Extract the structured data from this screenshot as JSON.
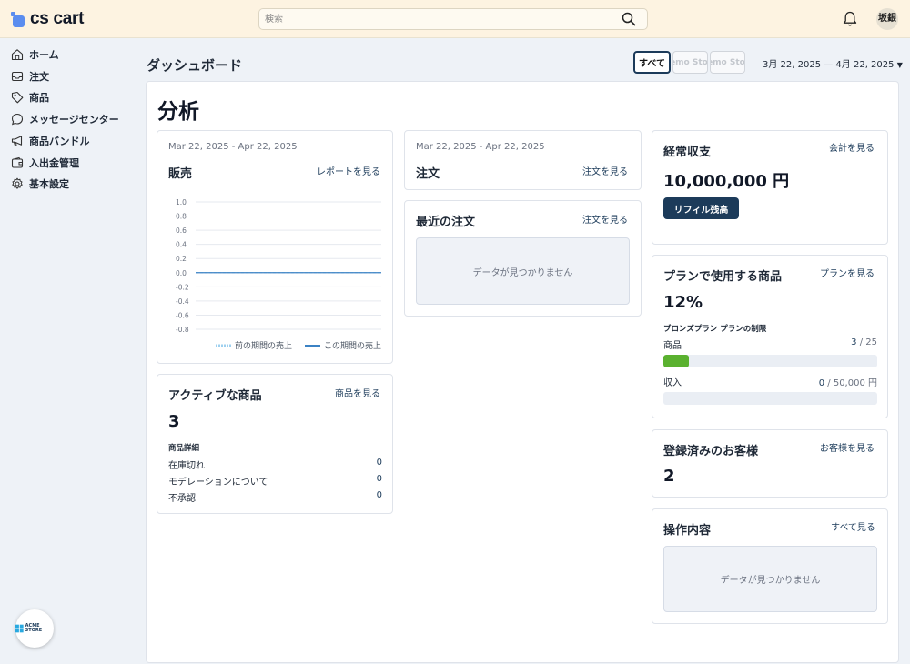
{
  "header": {
    "logo_text": "cs cart",
    "search_placeholder": "検索",
    "user_initials": "坂銀"
  },
  "sidebar": {
    "items": [
      {
        "label": "ホーム",
        "icon": "home-icon"
      },
      {
        "label": "注文",
        "icon": "inbox-icon"
      },
      {
        "label": "商品",
        "icon": "tag-icon"
      },
      {
        "label": "メッセージセンター",
        "icon": "chat-icon"
      },
      {
        "label": "商品バンドル",
        "icon": "megaphone-icon"
      },
      {
        "label": "入出金管理",
        "icon": "wallet-icon"
      },
      {
        "label": "基本設定",
        "icon": "gear-icon"
      }
    ],
    "store_logo_text": "ACME STORE"
  },
  "page": {
    "title": "ダッシュボード",
    "store_filters": [
      "すべて",
      "Demo Store",
      "Demo Store"
    ],
    "date_range": "3月 22, 2025 — 4月 22, 2025",
    "section_title": "分析"
  },
  "sales": {
    "date": "Mar 22, 2025 - Apr 22, 2025",
    "title": "販売",
    "link": "レポートを見る",
    "legend_prev": "前の期間の売上",
    "legend_curr": "この期間の売上"
  },
  "chart_data": {
    "type": "line",
    "ylim": [
      -0.8,
      1.0
    ],
    "yticks": [
      "1.0",
      "0.8",
      "0.6",
      "0.4",
      "0.2",
      "0.0",
      "-0.2",
      "-0.4",
      "-0.6",
      "-0.8"
    ],
    "series": [
      {
        "name": "前の期間の売上",
        "values": [
          0,
          0
        ],
        "color": "#9ed0ef"
      },
      {
        "name": "この期間の売上",
        "values": [
          0,
          0
        ],
        "color": "#3b82c4"
      }
    ],
    "grid": true,
    "legend": "bottom-right"
  },
  "orders": {
    "date": "Mar 22, 2025 - Apr 22, 2025",
    "title": "注文",
    "link": "注文を見る"
  },
  "recent_orders": {
    "title": "最近の注文",
    "link": "注文を見る",
    "empty": "データが見つかりません"
  },
  "active_products": {
    "title": "アクティブな商品",
    "link": "商品を見る",
    "value": "3",
    "details_title": "商品詳細",
    "rows": [
      {
        "label": "在庫切れ",
        "value": "0"
      },
      {
        "label": "モデレーションについて",
        "value": "0"
      },
      {
        "label": "不承認",
        "value": "0"
      }
    ]
  },
  "balance": {
    "title": "経常収支",
    "link": "会計を見る",
    "value": "10,000,000 円",
    "button": "リフィル残高"
  },
  "plan": {
    "title": "プランで使用する商品",
    "link": "プランを見る",
    "percent": "12%",
    "limits_title": "ブロンズプラン プランの制限",
    "products_label": "商品",
    "products_used": "3",
    "products_limit": "/ 25",
    "products_fraction": 0.12,
    "revenue_label": "収入",
    "revenue_used": "0",
    "revenue_limit": "/ 50,000 円",
    "revenue_fraction": 0
  },
  "customers": {
    "title": "登録済みのお客様",
    "link": "お客様を見る",
    "value": "2"
  },
  "activity": {
    "title": "操作内容",
    "link": "すべて見る",
    "empty": "データが見つかりません"
  }
}
